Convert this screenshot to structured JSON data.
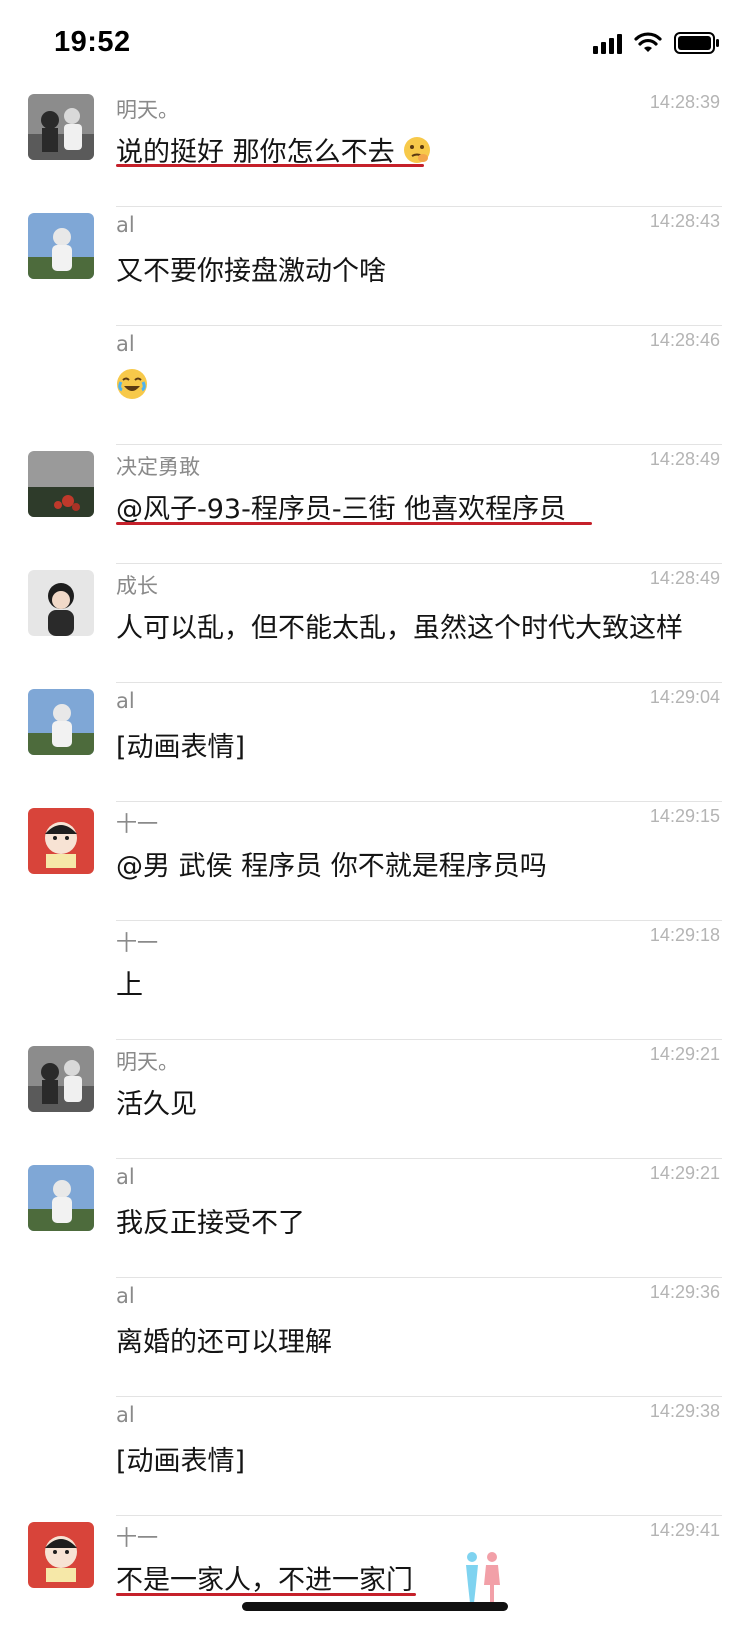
{
  "status_bar": {
    "time": "19:52",
    "icons": [
      "signal-icon",
      "wifi-icon",
      "battery-icon"
    ]
  },
  "colors": {
    "underline": "#c5202a",
    "sender": "#8a8a8a",
    "time": "#b4b4b4",
    "divider": "#e3e3e3"
  },
  "messages": [
    {
      "sender": "明天。",
      "time": "14:28:39",
      "text": "说的挺好 那你怎么不去",
      "avatar": "avatar-mingtian",
      "emoji": "thinking-emoji"
    },
    {
      "sender": "al",
      "time": "14:28:43",
      "text": "又不要你接盘激动个啥",
      "avatar": "avatar-al"
    },
    {
      "sender": "al",
      "time": "14:28:46",
      "text": "",
      "emoji": "laughing-crying-emoji"
    },
    {
      "sender": "决定勇敢",
      "time": "14:28:49",
      "text": "@风子-93-程序员-三街 他喜欢程序员",
      "avatar": "avatar-jueding"
    },
    {
      "sender": "成长",
      "time": "14:28:49",
      "text": "人可以乱，但不能太乱，虽然这个时代大致这样",
      "avatar": "avatar-chengzhang"
    },
    {
      "sender": "al",
      "time": "14:29:04",
      "text": "[动画表情]",
      "avatar": "avatar-al"
    },
    {
      "sender": "十一",
      "time": "14:29:15",
      "text": "@男 武侯 程序员 你不就是程序员吗",
      "avatar": "avatar-shiyi"
    },
    {
      "sender": "十一",
      "time": "14:29:18",
      "text": "上"
    },
    {
      "sender": "明天。",
      "time": "14:29:21",
      "text": "活久见",
      "avatar": "avatar-mingtian"
    },
    {
      "sender": "al",
      "time": "14:29:21",
      "text": "我反正接受不了",
      "avatar": "avatar-al"
    },
    {
      "sender": "al",
      "time": "14:29:36",
      "text": "离婚的还可以理解"
    },
    {
      "sender": "al",
      "time": "14:29:38",
      "text": "[动画表情]"
    },
    {
      "sender": "十一",
      "time": "14:29:41",
      "text": "不是一家人，不进一家门",
      "avatar": "avatar-shiyi"
    }
  ]
}
